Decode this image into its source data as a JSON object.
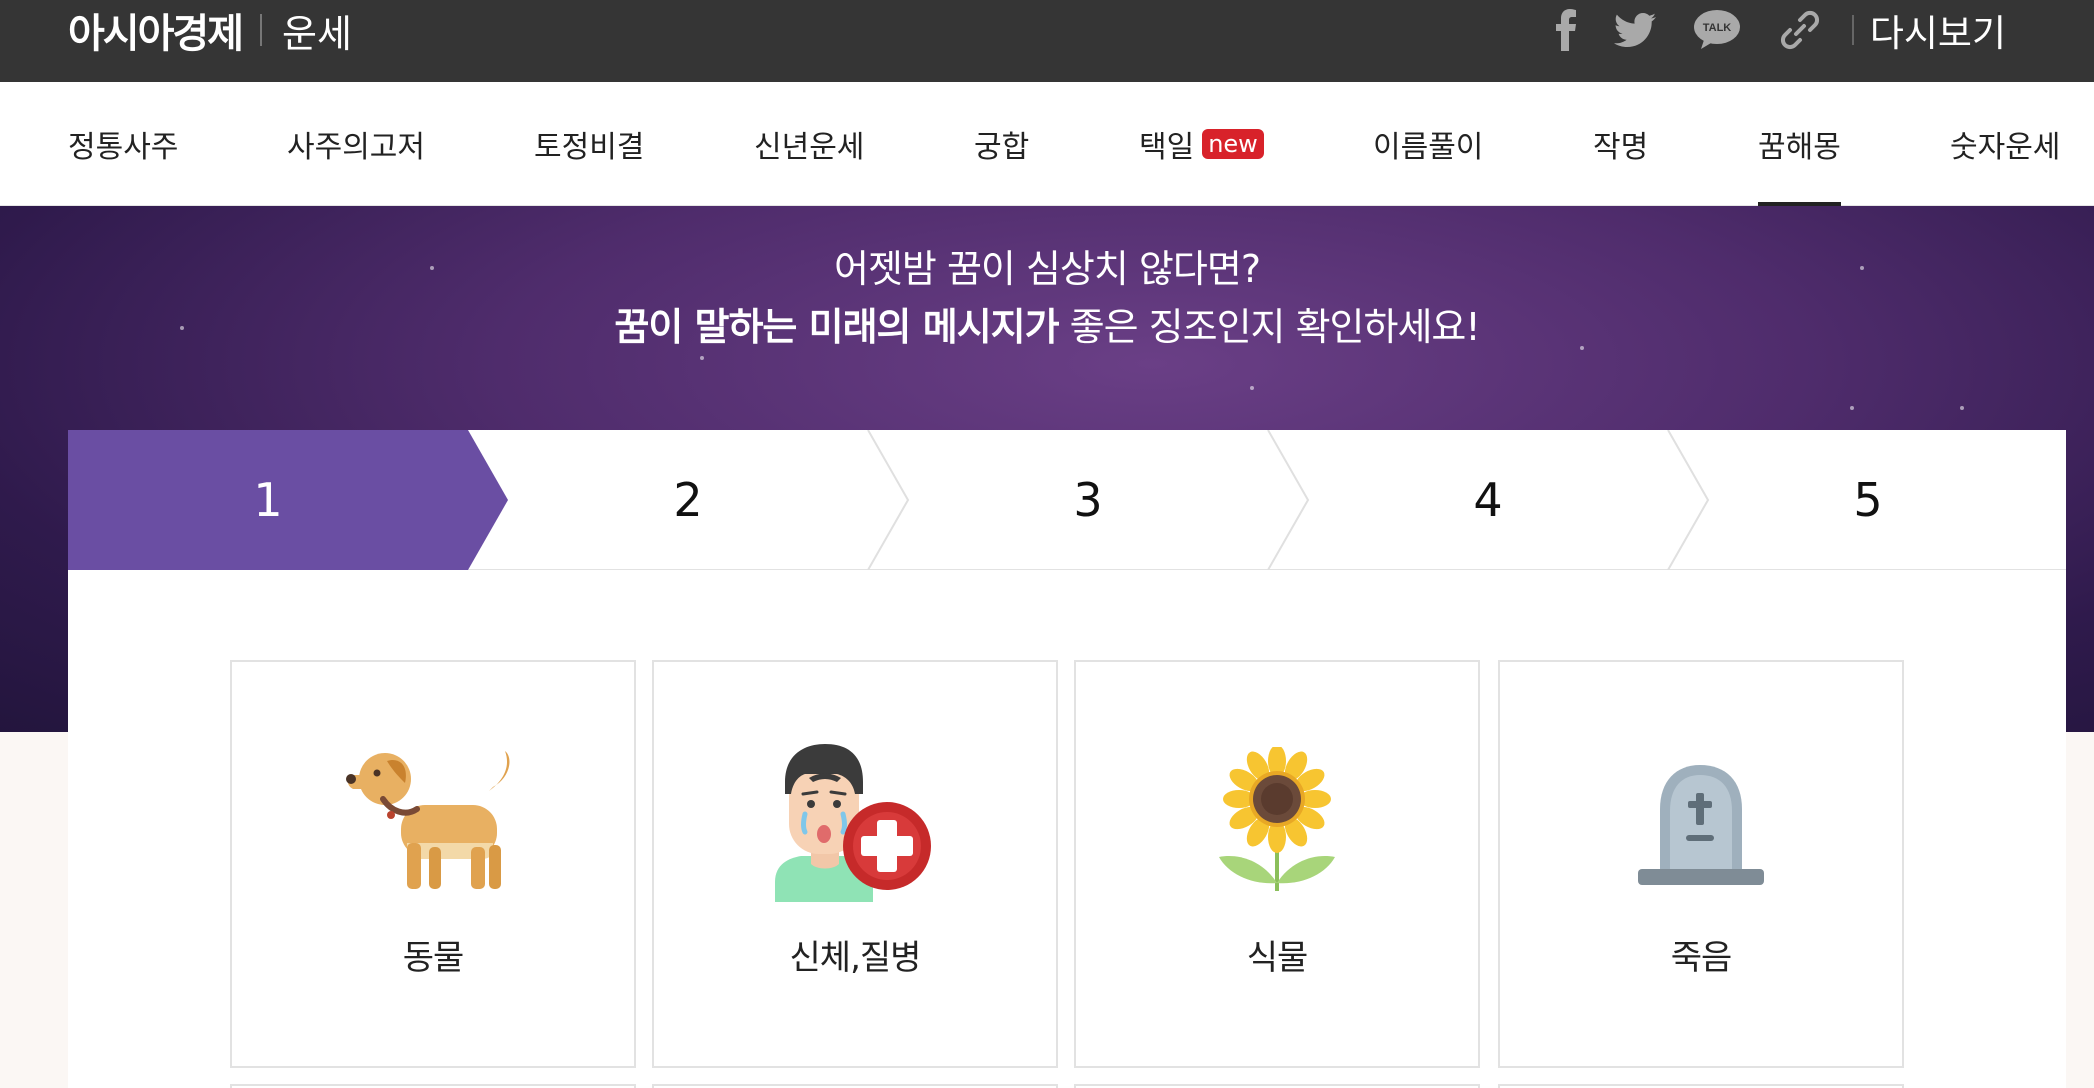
{
  "header": {
    "logo": "아시아경제",
    "section": "운세",
    "share_icons": [
      "facebook-icon",
      "twitter-icon",
      "kakaotalk-icon",
      "link-icon"
    ],
    "talk_label": "TALK",
    "replay_label": "다시보기"
  },
  "nav": {
    "items": [
      {
        "label": "정통사주"
      },
      {
        "label": "사주의고저"
      },
      {
        "label": "토정비결"
      },
      {
        "label": "신년운세"
      },
      {
        "label": "궁합"
      },
      {
        "label": "택일",
        "badge": "new"
      },
      {
        "label": "이름풀이"
      },
      {
        "label": "작명"
      },
      {
        "label": "꿈해몽",
        "active": true
      },
      {
        "label": "숫자운세"
      }
    ]
  },
  "hero": {
    "line1": "어젯밤 꿈이 심상치 않다면?",
    "line2_bold": "꿈이 말하는 미래의 메시지가",
    "line2_rest": " 좋은 징조인지 확인하세요!"
  },
  "steps": {
    "items": [
      "1",
      "2",
      "3",
      "4",
      "5"
    ],
    "active_index": 0,
    "active_color": "#6a4ea3"
  },
  "categories": [
    {
      "label": "동물",
      "icon": "dog-icon"
    },
    {
      "label": "신체,질병",
      "icon": "sick-person-icon"
    },
    {
      "label": "식물",
      "icon": "sunflower-icon"
    },
    {
      "label": "죽음",
      "icon": "tombstone-icon"
    }
  ],
  "colors": {
    "topbar": "#353535",
    "accent_purple": "#6a4ea3",
    "badge_red": "#d8222a"
  }
}
